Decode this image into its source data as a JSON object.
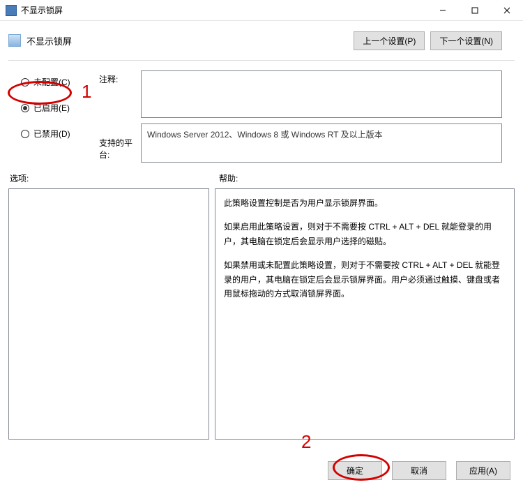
{
  "window": {
    "title": "不显示锁屏"
  },
  "header": {
    "title": "不显示锁屏"
  },
  "nav": {
    "prev": "上一个设置(P)",
    "next": "下一个设置(N)"
  },
  "radios": {
    "not_configured": "未配置(C)",
    "enabled": "已启用(E)",
    "disabled": "已禁用(D)",
    "selected": "enabled"
  },
  "labels": {
    "comment": "注释:",
    "platform": "支持的平台:",
    "options": "选项:",
    "help": "帮助:"
  },
  "platform_text": "Windows Server 2012、Windows 8 或 Windows RT 及以上版本",
  "help": {
    "p1": "此策略设置控制是否为用户显示锁屏界面。",
    "p2": "如果启用此策略设置，则对于不需要按 CTRL + ALT + DEL  就能登录的用户，其电脑在锁定后会显示用户选择的磁贴。",
    "p3": "如果禁用或未配置此策略设置，则对于不需要按 CTRL + ALT + DEL 就能登录的用户，其电脑在锁定后会显示锁屏界面。用户必须通过触摸、键盘或者用鼠标拖动的方式取消锁屏界面。"
  },
  "footer": {
    "ok": "确定",
    "cancel": "取消",
    "apply": "应用(A)"
  },
  "annotations": {
    "one": "1",
    "two": "2"
  }
}
